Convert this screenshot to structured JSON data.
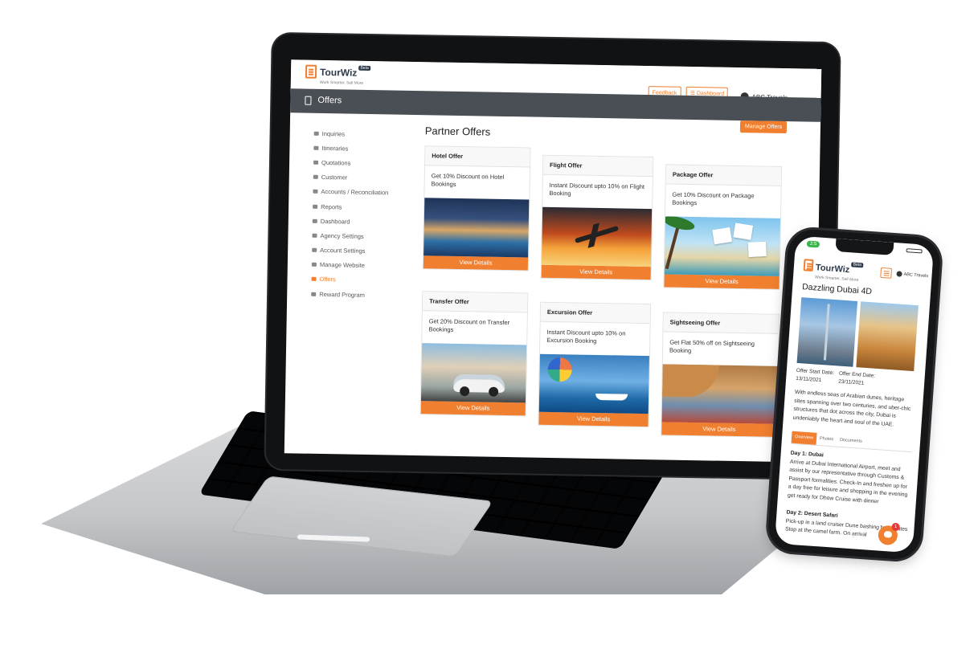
{
  "app": {
    "brand": "TourWiz",
    "badge": "Beta",
    "tagline": "Work Smarter, Sell More",
    "accent": "#f07f2f",
    "header_bg": "#4a4f55"
  },
  "topbar": {
    "feedback_label": "Feedback",
    "dashboard_label": "Dashboard",
    "user_name": "ABC Travels"
  },
  "header": {
    "title": "Offers"
  },
  "sidebar": {
    "items": [
      {
        "label": "Inquiries"
      },
      {
        "label": "Itineraries"
      },
      {
        "label": "Quotations"
      },
      {
        "label": "Customer"
      },
      {
        "label": "Accounts / Reconciliation"
      },
      {
        "label": "Reports"
      },
      {
        "label": "Dashboard"
      },
      {
        "label": "Agency Settings"
      },
      {
        "label": "Account Settings"
      },
      {
        "label": "Manage Website"
      },
      {
        "label": "Offers"
      },
      {
        "label": "Reward Program"
      }
    ],
    "active_item": "Offers"
  },
  "main": {
    "title": "Partner Offers",
    "manage_label": "Manage Offers",
    "cards": [
      {
        "title": "Hotel Offer",
        "text": "Get 10% Discount on Hotel Bookings",
        "button": "View Details",
        "image": "hotel-pool-photo"
      },
      {
        "title": "Flight Offer",
        "text": "Instant Discount upto 10% on Flight Booking",
        "button": "View Details",
        "image": "airplane-sunset-photo"
      },
      {
        "title": "Package Offer",
        "text": "Get 10% Discount on Package Bookings",
        "button": "View Details",
        "image": "beach-photos-collage"
      },
      {
        "title": "Transfer Offer",
        "text": "Get 20% Discount on Transfer Bookings",
        "button": "View Details",
        "image": "white-car-coast-photo"
      },
      {
        "title": "Excursion Offer",
        "text": "Instant Discount upto 10% on Excursion Booking",
        "button": "View Details",
        "image": "parasailing-sea-photo"
      },
      {
        "title": "Sightseeing Offer",
        "text": "Get Flat 50% off on Sightseeing Booking",
        "button": "View Details",
        "image": "traveler-moscow-photo"
      }
    ]
  },
  "phone": {
    "status_time": "2:5",
    "brand": "TourWiz",
    "badge": "Beta",
    "tagline": "Work Smarter, Sell More",
    "user_name": "ABC Travels",
    "title": "Dazzling Dubai 4D",
    "start_label": "Offer Start Date:",
    "start_date": "13/11/2021",
    "end_label": "Offer End Date:",
    "end_date": "23/11/2021",
    "description": "With endless seas of Arabian dunes, heritage sites spanning over two centuries, and uber-chic structures that dot across the city, Dubai is undeniably the heart and soul of the UAE.",
    "tabs": [
      {
        "label": "Overview"
      },
      {
        "label": "Photos"
      },
      {
        "label": "Documents"
      }
    ],
    "days": [
      {
        "heading": "Day 1: Dubai",
        "text": "Arrive at Dubai International Airport, meet and assist by our representative through Customs & Passport formalities. Check-In and freshen up for a day free for leisure and shopping in the evening get ready for Dhow Cruise with dinner"
      },
      {
        "heading": "Day 2: Desert Safari",
        "text": "Pick-up in a land cruiser Dune bashing for minutes Stop at the camel farm. On arrival"
      }
    ],
    "chat_count": "1"
  }
}
